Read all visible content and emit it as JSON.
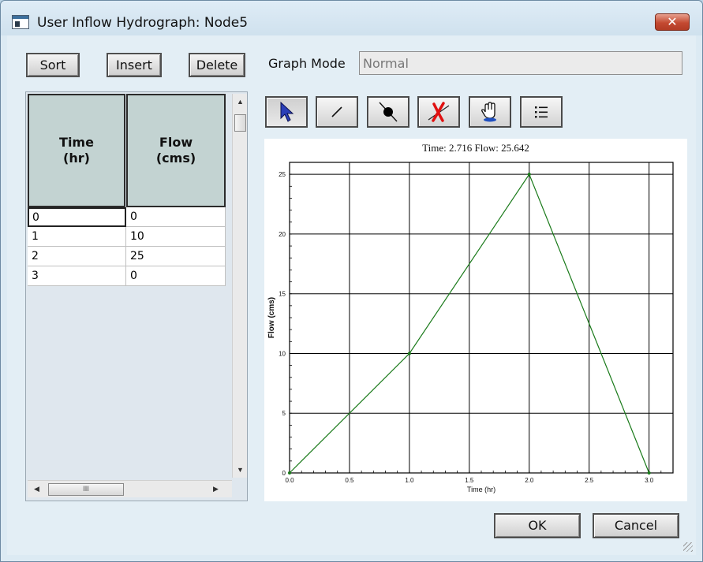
{
  "window": {
    "title": "User Inflow Hydrograph: Node5",
    "close_label": "✕"
  },
  "toolbar": {
    "sort_label": "Sort",
    "insert_label": "Insert",
    "delete_label": "Delete"
  },
  "graph_mode": {
    "label": "Graph Mode",
    "value": "Normal"
  },
  "table": {
    "headers": [
      {
        "line1": "Time",
        "line2": "(hr)"
      },
      {
        "line1": "Flow",
        "line2": "(cms)"
      }
    ],
    "rows": [
      {
        "time": "0",
        "flow": "0"
      },
      {
        "time": "1",
        "flow": "10"
      },
      {
        "time": "2",
        "flow": "25"
      },
      {
        "time": "3",
        "flow": "0"
      }
    ],
    "scroll_up": "▲",
    "scroll_down": "▼",
    "scroll_left": "◀",
    "scroll_right": "▶",
    "thumb_grip": "III"
  },
  "tools": [
    {
      "name": "select-tool",
      "icon": "pointer-arrow-icon"
    },
    {
      "name": "line-tool",
      "icon": "line-icon"
    },
    {
      "name": "point-tool",
      "icon": "point-icon"
    },
    {
      "name": "delete-point-tool",
      "icon": "red-x-icon"
    },
    {
      "name": "pan-tool",
      "icon": "hand-icon"
    },
    {
      "name": "list-tool",
      "icon": "list-icon"
    }
  ],
  "chart_data": {
    "type": "line",
    "title": "Time: 2.716 Flow: 25.642",
    "xlabel": "Time (hr)",
    "ylabel": "Flow (cms)",
    "xlim": [
      0,
      3.2
    ],
    "ylim": [
      0,
      26
    ],
    "xticks": [
      0.0,
      0.5,
      1.0,
      1.5,
      2.0,
      2.5,
      3.0
    ],
    "xtick_labels": [
      "0.0",
      "0.5",
      "1.0",
      "1.5",
      "2.0",
      "2.5",
      "3.0"
    ],
    "yticks": [
      0,
      5,
      10,
      15,
      20,
      25
    ],
    "ytick_labels": [
      "0",
      "5",
      "10",
      "15",
      "20",
      "25"
    ],
    "grid": true,
    "series": [
      {
        "x": [
          0,
          1,
          2,
          3
        ],
        "y": [
          0,
          10,
          25,
          0
        ],
        "color": "#1a7a1a"
      }
    ]
  },
  "footer": {
    "ok_label": "OK",
    "cancel_label": "Cancel"
  }
}
